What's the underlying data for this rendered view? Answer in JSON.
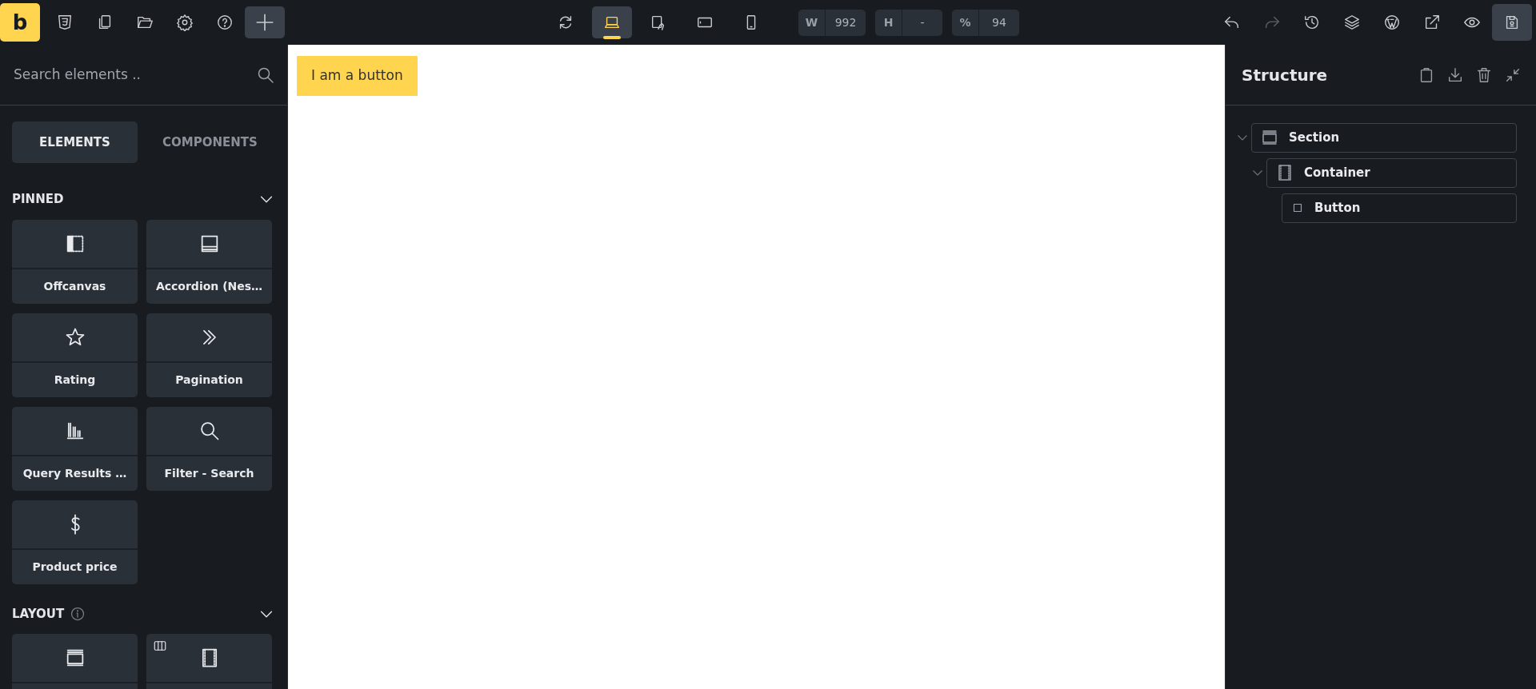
{
  "topbar": {
    "logo": "b",
    "left_tools": [
      {
        "kind": "css"
      },
      {
        "kind": "pages"
      },
      {
        "kind": "folder"
      },
      {
        "kind": "settings"
      },
      {
        "kind": "help"
      },
      {
        "kind": "add",
        "selected": true
      }
    ],
    "devices": [
      {
        "kind": "refresh",
        "selected": false
      },
      {
        "kind": "laptop",
        "selected": true
      },
      {
        "kind": "tablet-rotate",
        "selected": false
      },
      {
        "kind": "tablet",
        "selected": false
      },
      {
        "kind": "phone",
        "selected": false
      }
    ],
    "size_fields": [
      {
        "label": "W",
        "value": "992"
      },
      {
        "label": "H",
        "value": "-"
      },
      {
        "label": "%",
        "value": "94"
      }
    ],
    "right_tools": [
      {
        "kind": "undo",
        "disabled": false
      },
      {
        "kind": "redo",
        "disabled": true
      },
      {
        "kind": "history",
        "disabled": false
      },
      {
        "kind": "layers",
        "disabled": false
      },
      {
        "kind": "wordpress",
        "disabled": false
      },
      {
        "kind": "external",
        "disabled": false
      },
      {
        "kind": "preview",
        "disabled": false
      },
      {
        "kind": "save",
        "disabled": false
      }
    ]
  },
  "sidebar": {
    "search": {
      "placeholder": "Search elements .."
    },
    "tabs": [
      {
        "label": "ELEMENTS",
        "selected": true
      },
      {
        "label": "COMPONENTS",
        "selected": false
      }
    ],
    "sections": [
      {
        "title": "PINNED",
        "info": false,
        "expanded": true,
        "items": [
          {
            "kind": "offcanvas",
            "label": "Offcanvas"
          },
          {
            "kind": "accordion",
            "label": "Accordion (Nes…"
          },
          {
            "kind": "rating",
            "label": "Rating"
          },
          {
            "kind": "pagination",
            "label": "Pagination"
          },
          {
            "kind": "query",
            "label": "Query Results …"
          },
          {
            "kind": "search",
            "label": "Filter - Search"
          },
          {
            "kind": "price",
            "label": "Product price"
          }
        ]
      },
      {
        "title": "LAYOUT",
        "info": true,
        "expanded": true,
        "items": [
          {
            "kind": "section"
          },
          {
            "kind": "container",
            "badge": true
          }
        ]
      }
    ]
  },
  "canvas": {
    "button": "I am a button"
  },
  "structure": {
    "title": "Structure",
    "tree": [
      {
        "kind": "section",
        "label": "Section",
        "expanded": true,
        "children": [
          {
            "kind": "container",
            "label": "Container",
            "expanded": true,
            "children": [
              {
                "kind": "button",
                "label": "Button"
              }
            ]
          }
        ]
      }
    ]
  }
}
